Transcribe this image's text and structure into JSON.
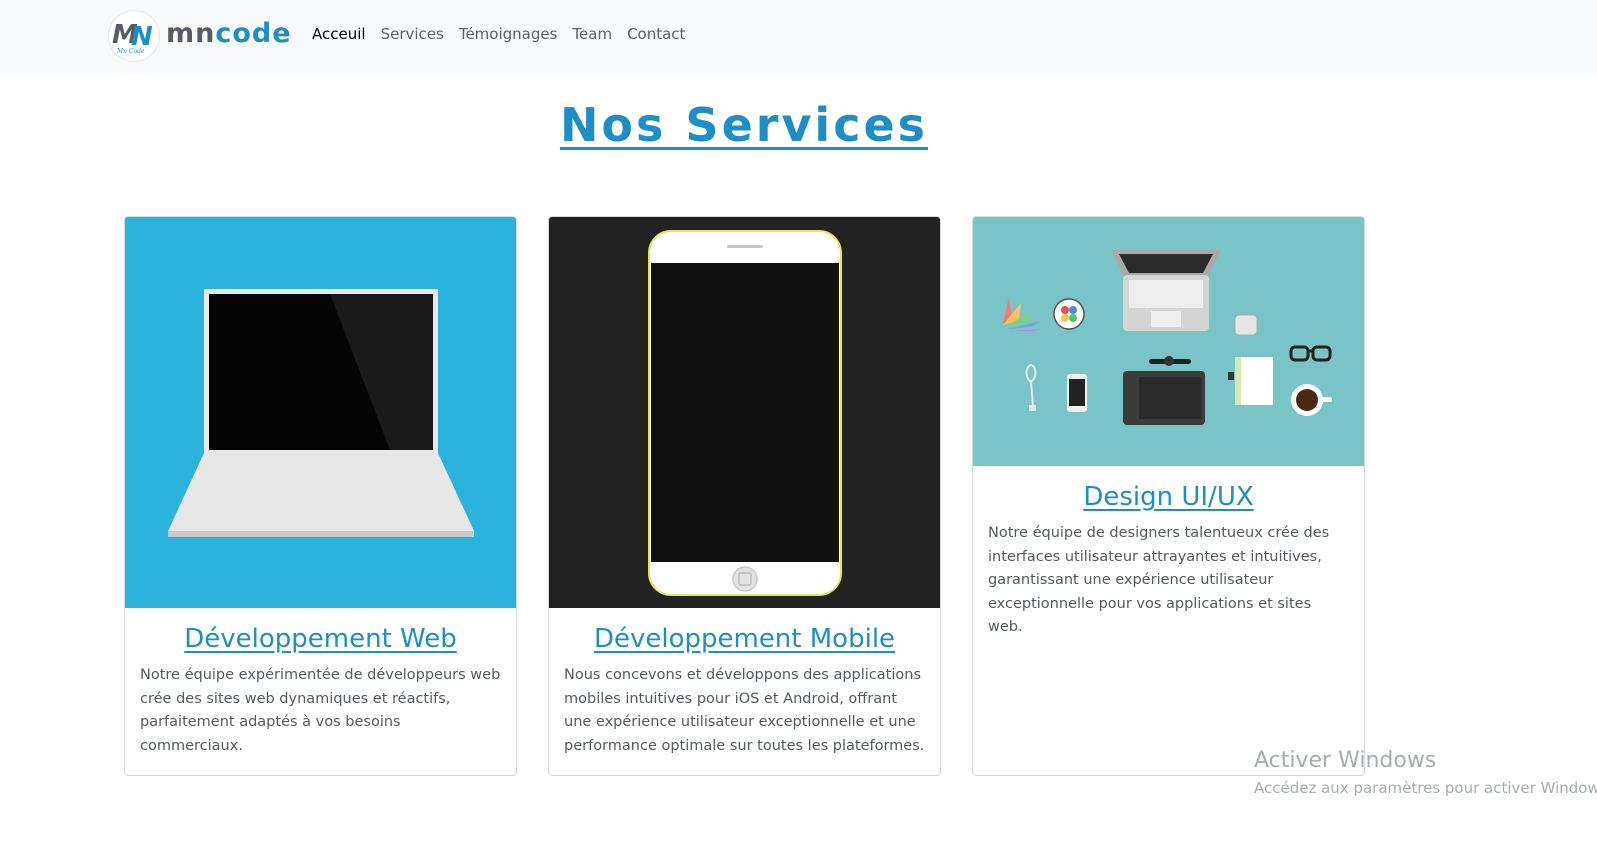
{
  "brand": {
    "prefix": "mn",
    "suffix": "code",
    "logo_caption": "Mn Code",
    "colors": {
      "primary": "#1e8fc6",
      "dark": "#555c63"
    }
  },
  "nav": {
    "items": [
      {
        "label": "Acceuil",
        "active": true
      },
      {
        "label": "Services",
        "active": false
      },
      {
        "label": "Témoignages",
        "active": false
      },
      {
        "label": "Team",
        "active": false
      },
      {
        "label": "Contact",
        "active": false
      }
    ]
  },
  "services": {
    "title": "Nos Services",
    "cards": [
      {
        "title": "Développement Web",
        "description": "Notre équipe expérimentée de développeurs web crée des sites web dynamiques et réactifs, parfaitement adaptés à vos besoins commerciaux.",
        "image": "laptop-illustration",
        "image_bg": "#2bb3de"
      },
      {
        "title": "Développement Mobile",
        "description": "Nous concevons et développons des applications mobiles intuitives pour iOS et Android, offrant une expérience utilisateur exceptionnelle et une performance optimale sur toutes les plateformes.",
        "image": "smartphone-illustration",
        "image_bg": "#222222"
      },
      {
        "title": "Design UI/UX",
        "description": "Notre équipe de designers talentueux crée des interfaces utilisateur attrayantes et intuitives, garantissant une expérience utilisateur exceptionnelle pour vos applications et sites web.",
        "image": "designer-desk-illustration",
        "image_bg": "#78c4c7"
      }
    ]
  },
  "watermark": {
    "title": "Activer Windows",
    "subtitle": "Accédez aux paramètres pour activer Windows."
  }
}
